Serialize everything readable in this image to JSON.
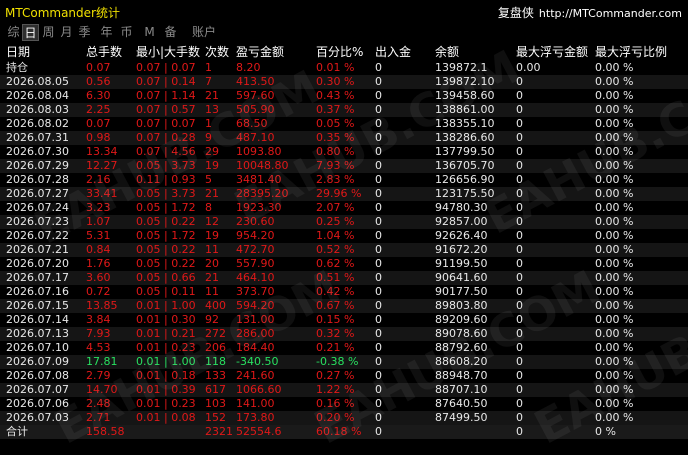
{
  "app_title": "MTCommander统计",
  "brand": {
    "name": "复盘侠",
    "url": "http://MTCommander.com"
  },
  "tabs": [
    {
      "label": "综",
      "active": false
    },
    {
      "label": "日",
      "active": true
    },
    {
      "label": "周",
      "active": false
    },
    {
      "label": "月",
      "active": false
    },
    {
      "label": "季",
      "active": false
    },
    {
      "label": "年",
      "active": false
    },
    {
      "label": "币",
      "active": false
    },
    {
      "label": "M",
      "active": false
    },
    {
      "label": "备",
      "active": false
    },
    {
      "label": "账户",
      "active": false
    }
  ],
  "columns": [
    "日期",
    "总手数",
    "最小|大手数",
    "次数",
    "盈亏金额",
    "百分比%",
    "出入金",
    "余额",
    "最大浮亏金额",
    "最大浮亏比例"
  ],
  "position_row": [
    "持仓",
    "0.07",
    "0.07 | 0.07",
    "1",
    "8.20",
    "0.01 %",
    "0",
    "139872.1",
    "0.00",
    "0.00 %"
  ],
  "rows": [
    [
      "2026.08.05",
      "0.56",
      "0.07 | 0.14",
      "7",
      "413.50",
      "0.30 %",
      "0",
      "139872.10",
      "0",
      "0.00 %"
    ],
    [
      "2026.08.04",
      "6.30",
      "0.07 | 1.14",
      "21",
      "597.60",
      "0.43 %",
      "0",
      "139458.60",
      "0",
      "0.00 %"
    ],
    [
      "2026.08.03",
      "2.25",
      "0.07 | 0.57",
      "13",
      "505.90",
      "0.37 %",
      "0",
      "138861.00",
      "0",
      "0.00 %"
    ],
    [
      "2026.08.02",
      "0.07",
      "0.07 | 0.07",
      "1",
      "68.50",
      "0.05 %",
      "0",
      "138355.10",
      "0",
      "0.00 %"
    ],
    [
      "2026.07.31",
      "0.98",
      "0.07 | 0.28",
      "9",
      "487.10",
      "0.35 %",
      "0",
      "138286.60",
      "0",
      "0.00 %"
    ],
    [
      "2026.07.30",
      "13.34",
      "0.07 | 4.56",
      "29",
      "1093.80",
      "0.80 %",
      "0",
      "137799.50",
      "0",
      "0.00 %"
    ],
    [
      "2026.07.29",
      "12.27",
      "0.05 | 3.73",
      "19",
      "10048.80",
      "7.93 %",
      "0",
      "136705.70",
      "0",
      "0.00 %"
    ],
    [
      "2026.07.28",
      "2.16",
      "0.11 | 0.93",
      "5",
      "3481.40",
      "2.83 %",
      "0",
      "126656.90",
      "0",
      "0.00 %"
    ],
    [
      "2026.07.27",
      "33.41",
      "0.05 | 3.73",
      "21",
      "28395.20",
      "29.96 %",
      "0",
      "123175.50",
      "0",
      "0.00 %"
    ],
    [
      "2026.07.24",
      "3.23",
      "0.05 | 1.72",
      "8",
      "1923.30",
      "2.07 %",
      "0",
      "94780.30",
      "0",
      "0.00 %"
    ],
    [
      "2026.07.23",
      "1.07",
      "0.05 | 0.22",
      "12",
      "230.60",
      "0.25 %",
      "0",
      "92857.00",
      "0",
      "0.00 %"
    ],
    [
      "2026.07.22",
      "5.31",
      "0.05 | 1.72",
      "19",
      "954.20",
      "1.04 %",
      "0",
      "92626.40",
      "0",
      "0.00 %"
    ],
    [
      "2026.07.21",
      "0.84",
      "0.05 | 0.22",
      "11",
      "472.70",
      "0.52 %",
      "0",
      "91672.20",
      "0",
      "0.00 %"
    ],
    [
      "2026.07.20",
      "1.76",
      "0.05 | 0.22",
      "20",
      "557.90",
      "0.62 %",
      "0",
      "91199.50",
      "0",
      "0.00 %"
    ],
    [
      "2026.07.17",
      "3.60",
      "0.05 | 0.66",
      "21",
      "464.10",
      "0.51 %",
      "0",
      "90641.60",
      "0",
      "0.00 %"
    ],
    [
      "2026.07.16",
      "0.72",
      "0.05 | 0.11",
      "11",
      "373.70",
      "0.42 %",
      "0",
      "90177.50",
      "0",
      "0.00 %"
    ],
    [
      "2026.07.15",
      "13.85",
      "0.01 | 1.00",
      "400",
      "594.20",
      "0.67 %",
      "0",
      "89803.80",
      "0",
      "0.00 %"
    ],
    [
      "2026.07.14",
      "3.84",
      "0.01 | 0.30",
      "92",
      "131.00",
      "0.15 %",
      "0",
      "89209.60",
      "0",
      "0.00 %"
    ],
    [
      "2026.07.13",
      "7.93",
      "0.01 | 0.21",
      "272",
      "286.00",
      "0.32 %",
      "0",
      "89078.60",
      "0",
      "0.00 %"
    ],
    [
      "2026.07.10",
      "4.53",
      "0.01 | 0.23",
      "206",
      "184.40",
      "0.21 %",
      "0",
      "88792.60",
      "0",
      "0.00 %"
    ],
    [
      "2026.07.09",
      "17.81",
      "0.01 | 1.00",
      "118",
      "-340.50",
      "-0.38 %",
      "0",
      "88608.20",
      "0",
      "0.00 %"
    ],
    [
      "2026.07.08",
      "2.79",
      "0.01 | 0.18",
      "133",
      "241.60",
      "0.27 %",
      "0",
      "88948.70",
      "0",
      "0.00 %"
    ],
    [
      "2026.07.07",
      "14.70",
      "0.01 | 0.39",
      "617",
      "1066.60",
      "1.22 %",
      "0",
      "88707.10",
      "0",
      "0.00 %"
    ],
    [
      "2026.07.06",
      "2.48",
      "0.01 | 0.23",
      "103",
      "141.00",
      "0.16 %",
      "0",
      "87640.50",
      "0",
      "0.00 %"
    ],
    [
      "2026.07.03",
      "2.71",
      "0.01 | 0.08",
      "152",
      "173.80",
      "0.20 %",
      "0",
      "87499.50",
      "0",
      "0.00 %"
    ]
  ],
  "total_row": [
    "合计",
    "158.58",
    "",
    "2321",
    "52554.6",
    "60.18 %",
    "0",
    "",
    "0",
    "0 %"
  ],
  "watermark": "EAHUB.COM",
  "colors": {
    "profit": "#e01818",
    "loss": "#28e060",
    "title": "#f0e000",
    "background": "#000000"
  }
}
